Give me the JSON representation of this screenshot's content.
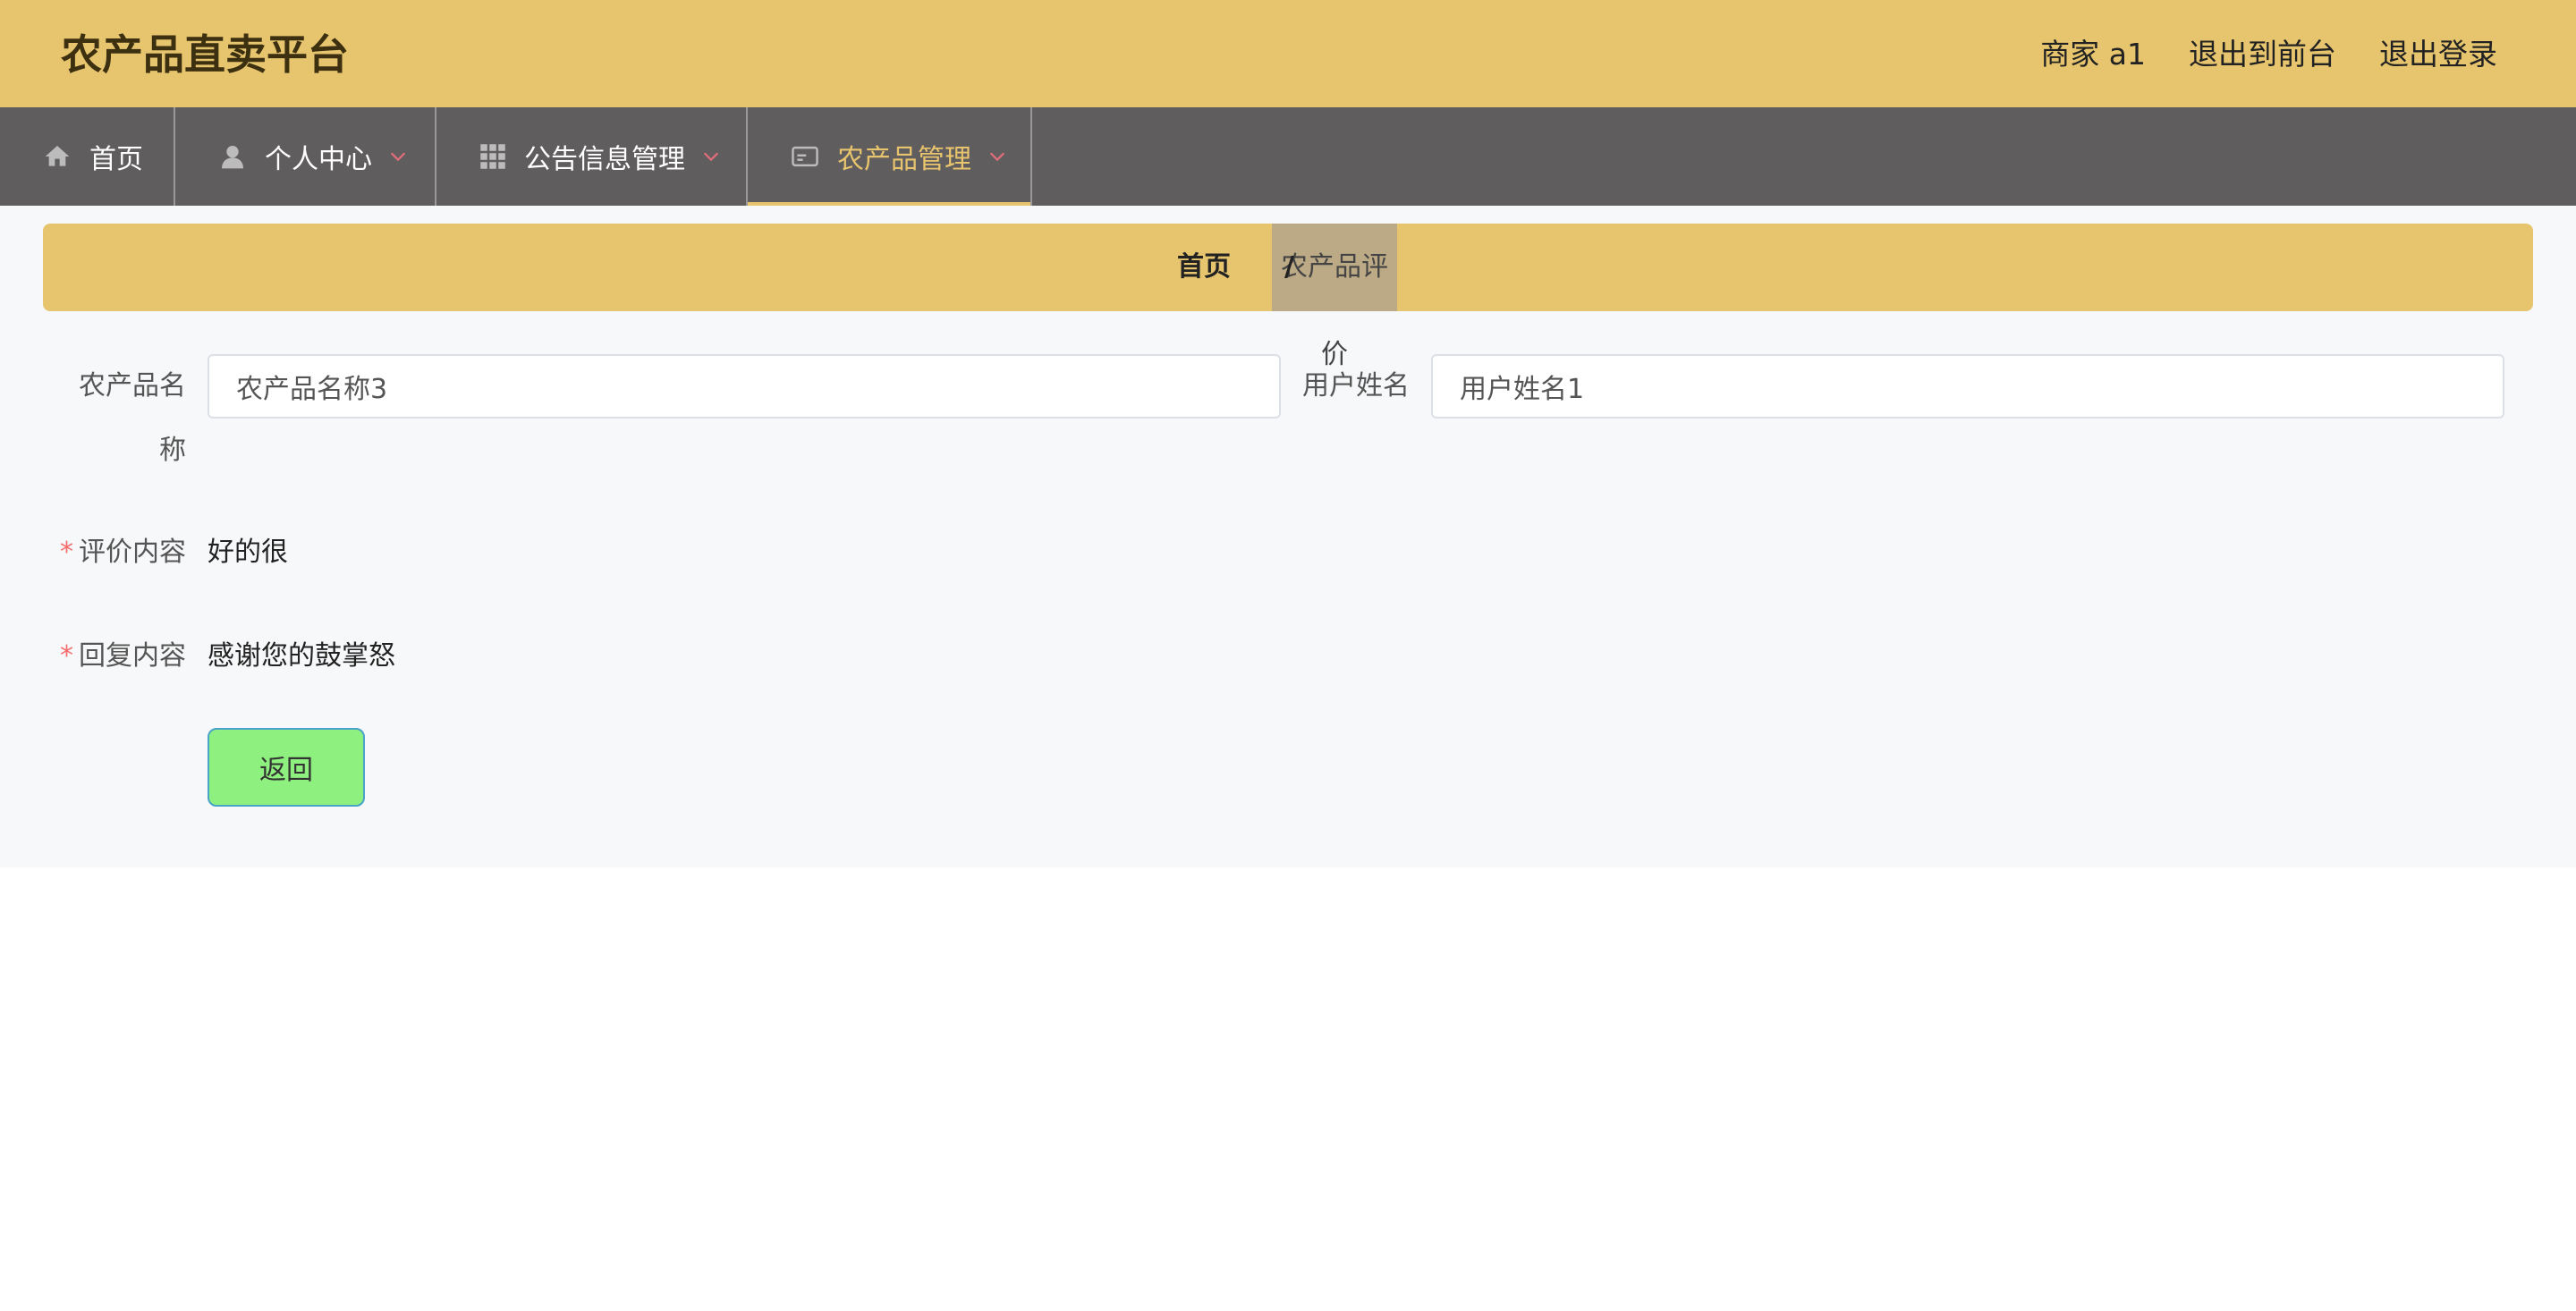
{
  "header": {
    "title": "农产品直卖平台",
    "links": [
      "商家 a1",
      "退出到前台",
      "退出登录"
    ]
  },
  "nav": {
    "items": [
      {
        "label": "首页",
        "icon": "home-icon",
        "has_dropdown": false,
        "active": false
      },
      {
        "label": "个人中心",
        "icon": "user-icon",
        "has_dropdown": true,
        "active": false
      },
      {
        "label": "公告信息管理",
        "icon": "grid-icon",
        "has_dropdown": true,
        "active": false
      },
      {
        "label": "农产品管理",
        "icon": "card-icon",
        "has_dropdown": true,
        "active": true
      }
    ]
  },
  "breadcrumb": {
    "home": "首页",
    "separator": "/",
    "current": "农产品评价"
  },
  "form": {
    "product_name_label_line1": "农产品名",
    "product_name_label_line2": "称",
    "product_name_value": "农产品名称3",
    "user_name_label": "用户姓名",
    "user_name_value": "用户姓名1",
    "review_label": "评价内容",
    "review_value": "好的很",
    "reply_label": "回复内容",
    "reply_value": "感谢您的鼓掌怒",
    "required_mark": "*"
  },
  "actions": {
    "back_label": "返回"
  },
  "colors": {
    "header_bg": "#e7c56e",
    "nav_bg": "#5f5d5e",
    "nav_active": "#e9c46e",
    "dropdown_chevron": "#e06c7a",
    "button_bg": "#8ef07e",
    "required": "#f56c6c"
  }
}
